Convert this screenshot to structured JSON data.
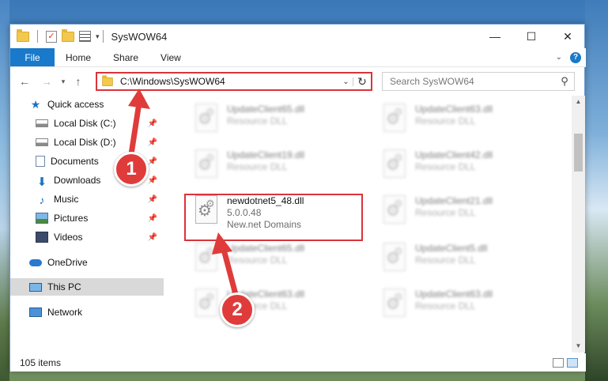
{
  "window": {
    "title": "SysWOW64",
    "controls": {
      "minimize": "—",
      "maximize": "☐",
      "close": "✕"
    }
  },
  "ribbon": {
    "file_tab": "File",
    "tabs": [
      "Home",
      "Share",
      "View"
    ]
  },
  "address_bar": {
    "path": "C:\\Windows\\SysWOW64"
  },
  "search": {
    "placeholder": "Search SysWOW64"
  },
  "sidebar": {
    "quick_access": "Quick access",
    "items": [
      {
        "label": "Local Disk (C:)",
        "icon": "drive-icon",
        "pinned": true
      },
      {
        "label": "Local Disk (D:)",
        "icon": "drive-icon",
        "pinned": true
      },
      {
        "label": "Documents",
        "icon": "documents-icon",
        "pinned": true
      },
      {
        "label": "Downloads",
        "icon": "downloads-icon",
        "pinned": true
      },
      {
        "label": "Music",
        "icon": "music-icon",
        "pinned": true
      },
      {
        "label": "Pictures",
        "icon": "pictures-icon",
        "pinned": true
      },
      {
        "label": "Videos",
        "icon": "videos-icon",
        "pinned": true
      }
    ],
    "onedrive": "OneDrive",
    "this_pc": "This PC",
    "network": "Network"
  },
  "files": {
    "highlighted": {
      "name": "newdotnet5_48.dll",
      "version": "5.0.0.48",
      "company": "New.net Domains"
    },
    "blurred": [
      {
        "name": "UpdateClient65.dll",
        "type": "Resource DLL"
      },
      {
        "name": "UpdateClient63.dll",
        "type": "Resource DLL"
      },
      {
        "name": "UpdateClient19.dll",
        "type": "Resource DLL"
      },
      {
        "name": "UpdateClient42.dll",
        "type": "Resource DLL"
      },
      {
        "name": "UpdateClient21.dll",
        "type": "Resource DLL"
      },
      {
        "name": "UpdateClient65.dll",
        "type": "Resource DLL"
      },
      {
        "name": "UpdateClient5.dll",
        "type": "Resource DLL"
      },
      {
        "name": "UpdateClient63.dll",
        "type": "Resource DLL"
      },
      {
        "name": "UpdateClient63.dll",
        "type": "Resource DLL"
      }
    ]
  },
  "status": {
    "item_count": "105 items"
  },
  "annotations": {
    "step1": "1",
    "step2": "2",
    "color": "#e03b3b"
  }
}
